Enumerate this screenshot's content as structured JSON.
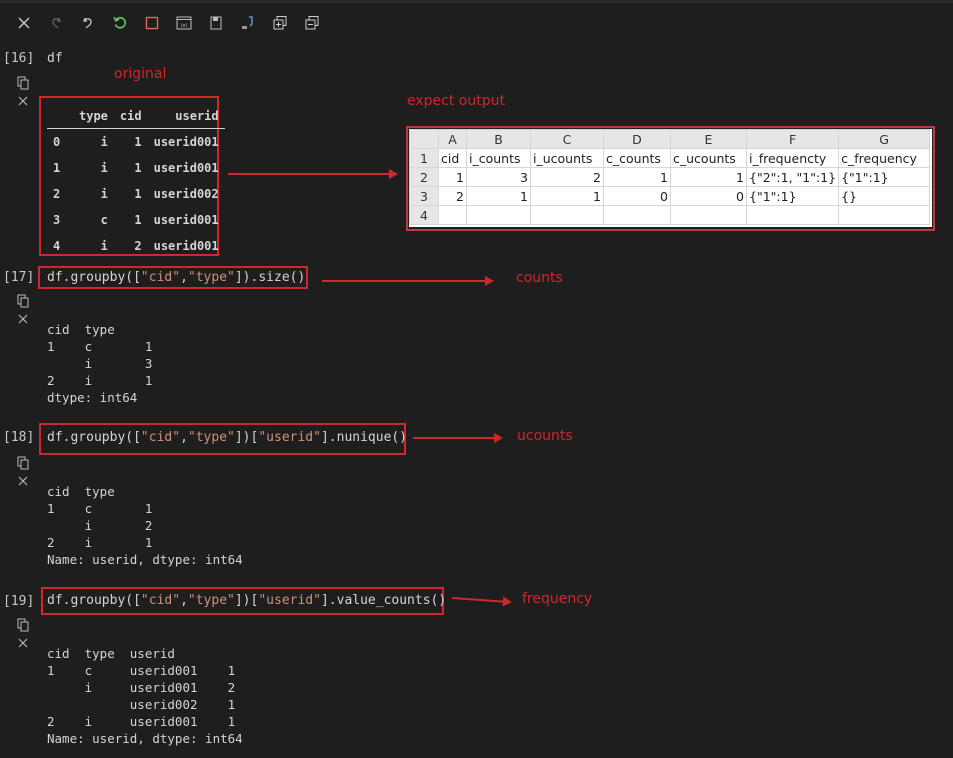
{
  "toolbar": {
    "buttons": [
      {
        "icon": "close-icon",
        "label": "Clear"
      },
      {
        "icon": "redo-icon",
        "label": "Redo"
      },
      {
        "icon": "undo-icon",
        "label": "Undo"
      },
      {
        "icon": "restart-icon",
        "label": "Restart"
      },
      {
        "icon": "stop-icon",
        "label": "Interrupt"
      },
      {
        "icon": "variables-icon",
        "label": "Variables"
      },
      {
        "icon": "save-icon",
        "label": "Save"
      },
      {
        "icon": "export-icon",
        "label": "Export"
      },
      {
        "icon": "expand-all-icon",
        "label": "Expand all"
      },
      {
        "icon": "collapse-all-icon",
        "label": "Collapse all"
      }
    ]
  },
  "cells": [
    {
      "number": "[16]",
      "code": "df",
      "annotation": "original",
      "table": {
        "columns": [
          "",
          "type",
          "cid",
          "userid"
        ],
        "rows": [
          [
            "0",
            "i",
            "1",
            "userid001"
          ],
          [
            "1",
            "i",
            "1",
            "userid001"
          ],
          [
            "2",
            "i",
            "1",
            "userid002"
          ],
          [
            "3",
            "c",
            "1",
            "userid001"
          ],
          [
            "4",
            "i",
            "2",
            "userid001"
          ]
        ]
      }
    },
    {
      "number": "[17]",
      "code_parts": [
        "df.groupby([",
        "\"cid\"",
        ",",
        "\"type\"",
        "]).size()"
      ],
      "annotation": "counts",
      "output": "cid  type\n1    c       1\n     i       3\n2    i       1\ndtype: int64"
    },
    {
      "number": "[18]",
      "code_parts": [
        "df.groupby([",
        "\"cid\"",
        ",",
        "\"type\"",
        "])[",
        "\"userid\"",
        "].nunique()"
      ],
      "annotation": "ucounts",
      "output": "cid  type\n1    c       1\n     i       2\n2    i       1\nName: userid, dtype: int64"
    },
    {
      "number": "[19]",
      "code_parts": [
        "df.groupby([",
        "\"cid\"",
        ",",
        "\"type\"",
        "])[",
        "\"userid\"",
        "].value_counts()"
      ],
      "annotation": "frequency",
      "output": "cid  type  userid\n1    c     userid001    1\n     i     userid001    2\n           userid002    1\n2    i     userid001    1\nName: userid, dtype: int64"
    }
  ],
  "expect": {
    "annotation": "expect output",
    "col_headers": [
      "",
      "A",
      "B",
      "C",
      "D",
      "E",
      "F",
      "G"
    ],
    "rows": [
      [
        "1",
        "cid",
        "i_counts",
        "i_ucounts",
        "c_counts",
        "c_ucounts",
        "i_frequencty",
        "c_frequency"
      ],
      [
        "2",
        "1",
        "3",
        "2",
        "1",
        "1",
        "{\"2\":1, \"1\":1}",
        "{\"1\":1}"
      ],
      [
        "3",
        "2",
        "1",
        "1",
        "0",
        "0",
        "{\"1\":1}",
        "{}"
      ],
      [
        "4",
        "",
        "",
        "",
        "",
        "",
        "",
        ""
      ]
    ]
  }
}
